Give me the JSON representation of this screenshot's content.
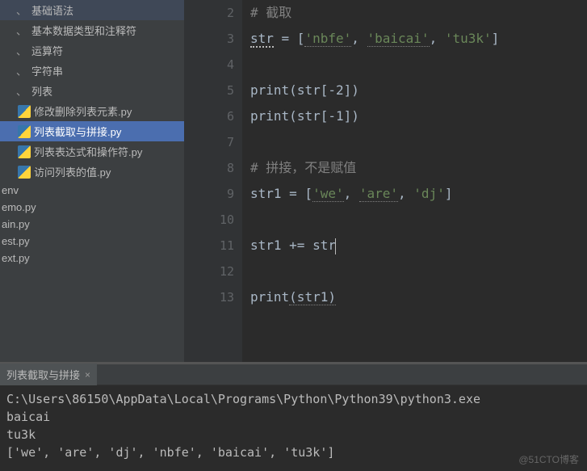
{
  "sidebar": {
    "items": [
      {
        "label": "基础语法",
        "type": "folder"
      },
      {
        "label": "基本数据类型和注释符",
        "type": "folder"
      },
      {
        "label": "运算符",
        "type": "folder"
      },
      {
        "label": "字符串",
        "type": "folder"
      },
      {
        "label": "列表",
        "type": "folder"
      },
      {
        "label": "修改删除列表元素.py",
        "type": "file"
      },
      {
        "label": "列表截取与拼接.py",
        "type": "file",
        "selected": true
      },
      {
        "label": "列表表达式和操作符.py",
        "type": "file"
      },
      {
        "label": "访问列表的值.py",
        "type": "file"
      },
      {
        "label": "env",
        "type": "plain"
      },
      {
        "label": "emo.py",
        "type": "plain"
      },
      {
        "label": "ain.py",
        "type": "plain"
      },
      {
        "label": "est.py",
        "type": "plain"
      },
      {
        "label": "ext.py",
        "type": "plain"
      }
    ]
  },
  "editor": {
    "lines": [
      {
        "n": "2",
        "seg": [
          {
            "t": "# 截取",
            "c": "comment"
          }
        ]
      },
      {
        "n": "3",
        "seg": [
          {
            "t": "str",
            "c": "ident strw"
          },
          {
            "t": " = [",
            "c": "op"
          },
          {
            "t": "'nbfe'",
            "c": "string wavy"
          },
          {
            "t": ", ",
            "c": "op"
          },
          {
            "t": "'baicai'",
            "c": "string wavy"
          },
          {
            "t": ", ",
            "c": "op"
          },
          {
            "t": "'tu3k'",
            "c": "string"
          },
          {
            "t": "]",
            "c": "op"
          }
        ]
      },
      {
        "n": "4",
        "seg": []
      },
      {
        "n": "5",
        "seg": [
          {
            "t": "print",
            "c": "func"
          },
          {
            "t": "(",
            "c": "op"
          },
          {
            "t": "str",
            "c": "ident"
          },
          {
            "t": "[-",
            "c": "op"
          },
          {
            "t": "2",
            "c": "ident"
          },
          {
            "t": "])",
            "c": "op"
          }
        ]
      },
      {
        "n": "6",
        "seg": [
          {
            "t": "print",
            "c": "func"
          },
          {
            "t": "(",
            "c": "op"
          },
          {
            "t": "str",
            "c": "ident"
          },
          {
            "t": "[-",
            "c": "op"
          },
          {
            "t": "1",
            "c": "ident"
          },
          {
            "t": "])",
            "c": "op"
          }
        ]
      },
      {
        "n": "7",
        "seg": []
      },
      {
        "n": "8",
        "seg": [
          {
            "t": "# 拼接，不是赋值",
            "c": "comment"
          }
        ]
      },
      {
        "n": "9",
        "seg": [
          {
            "t": "str1 = [",
            "c": "ident"
          },
          {
            "t": "'we'",
            "c": "string wavy"
          },
          {
            "t": ", ",
            "c": "op"
          },
          {
            "t": "'are'",
            "c": "string wavy"
          },
          {
            "t": ", ",
            "c": "op"
          },
          {
            "t": "'dj'",
            "c": "string"
          },
          {
            "t": "]",
            "c": "op"
          }
        ]
      },
      {
        "n": "10",
        "seg": []
      },
      {
        "n": "11",
        "seg": [
          {
            "t": "str1 += ",
            "c": "ident"
          },
          {
            "t": "str",
            "c": "ident"
          },
          {
            "cursor": true
          }
        ]
      },
      {
        "n": "12",
        "seg": []
      },
      {
        "n": "13",
        "seg": [
          {
            "t": "print",
            "c": "func"
          },
          {
            "t": "(str1)",
            "c": "ident wavy"
          }
        ]
      }
    ]
  },
  "console": {
    "tab": "列表截取与拼接",
    "lines": [
      "C:\\Users\\86150\\AppData\\Local\\Programs\\Python\\Python39\\python3.exe",
      "baicai",
      "tu3k",
      "['we', 'are', 'dj', 'nbfe', 'baicai', 'tu3k']"
    ]
  },
  "watermark": "@51CTO博客"
}
